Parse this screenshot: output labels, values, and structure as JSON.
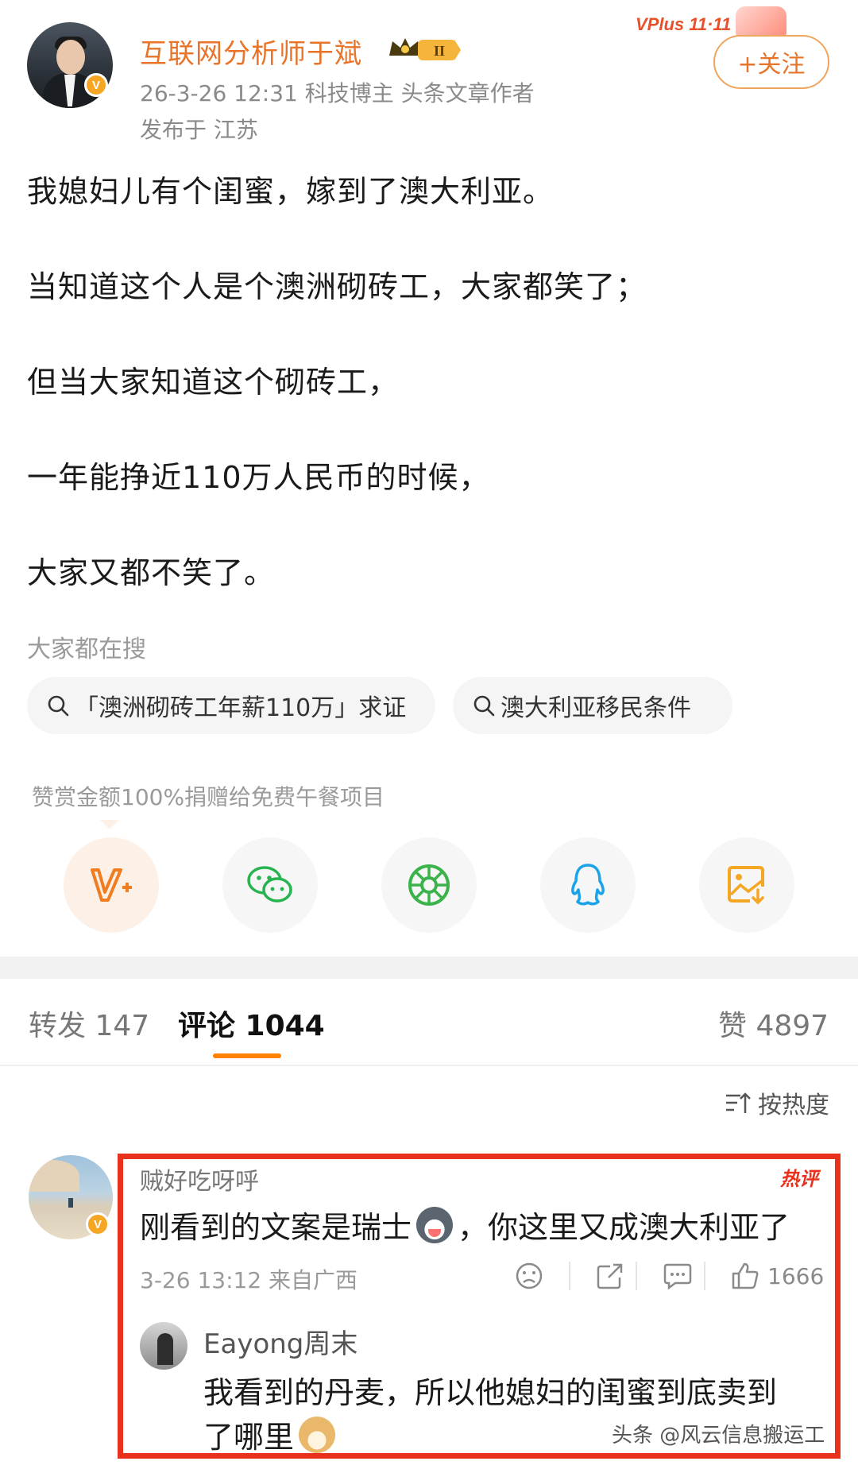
{
  "author": {
    "name": "互联网分析师于斌",
    "meta": "26-3-26 12:31  科技博主 头条文章作者",
    "location": "发布于 江苏",
    "level_badge": "II"
  },
  "promo": {
    "label": "VPlus 11·11"
  },
  "follow_label": "+关注",
  "post": {
    "lines": [
      "我媳妇儿有个闺蜜，嫁到了澳大利亚。",
      "当知道这个人是个澳洲砌砖工，大家都笑了；",
      "但当大家知道这个砌砖工，",
      "一年能挣近110万人民币的时候，",
      "大家又都不笑了。"
    ]
  },
  "search": {
    "title": "大家都在搜",
    "items": [
      "「澳洲砌砖工年薪110万」求证",
      "澳大利亚移民条件"
    ]
  },
  "reward_text": "赞赏金额100%捐赠给免费午餐项目",
  "share_icons": [
    "vip-plus-icon",
    "wechat-icon",
    "moments-icon",
    "qq-icon",
    "save-image-icon"
  ],
  "tabs": {
    "repost": "转发 147",
    "comments": "评论 1044",
    "likes": "赞 4897"
  },
  "sort_label": "按热度",
  "comment": {
    "user": "贼好吃呀呼",
    "tag": "热评",
    "text_before": "刚看到的文案是瑞士",
    "text_after": "，你这里又成澳大利亚了",
    "meta": "3-26 13:12 来自广西",
    "like_count": "1666",
    "reply": {
      "user": "Eayong周末",
      "text_line1": "我看到的丹麦，所以他媳妇的闺蜜到底卖到",
      "text_line2": "了哪里"
    }
  },
  "watermark": "头条 @风云信息搬运工",
  "colors": {
    "accent": "#e8742a",
    "highlight_border": "#e8321e",
    "tab_underline": "#ff8200",
    "verified": "#f5a623"
  }
}
